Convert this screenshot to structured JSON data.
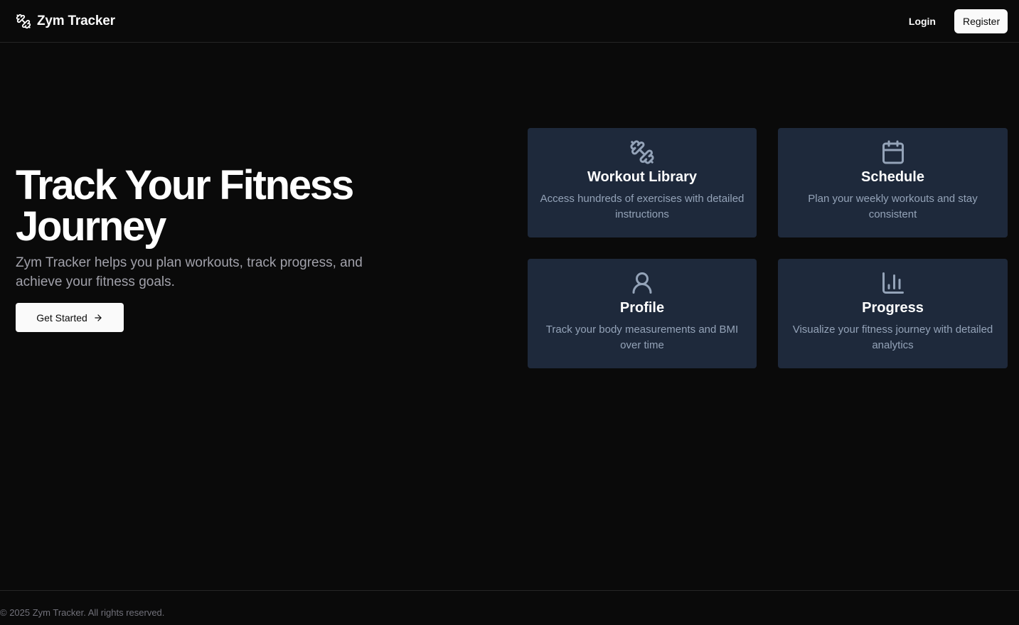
{
  "header": {
    "brand_name": "Zym Tracker",
    "brand_icon": "dumbbell-icon",
    "login_label": "Login",
    "register_label": "Register"
  },
  "hero": {
    "title_line1": "Track Your Fitness",
    "title_line2": "Journey",
    "subtitle": "Zym Tracker helps you plan workouts, track progress, and achieve your fitness goals.",
    "cta_label": "Get Started",
    "cta_icon": "arrow-right-icon"
  },
  "features": [
    {
      "icon": "dumbbell-icon",
      "title": "Workout Library",
      "description": "Access hundreds of exercises with detailed instructions"
    },
    {
      "icon": "calendar-icon",
      "title": "Schedule",
      "description": "Plan your weekly workouts and stay consistent"
    },
    {
      "icon": "user-icon",
      "title": "Profile",
      "description": "Track your body measurements and BMI over time"
    },
    {
      "icon": "bar-chart-icon",
      "title": "Progress",
      "description": "Visualize your fitness journey with detailed analytics"
    }
  ],
  "footer": {
    "copyright": "© 2025 Zym Tracker. All rights reserved."
  },
  "colors": {
    "background": "#0a0a0a",
    "card_background": "#1e293b",
    "muted_text": "#94a3b8",
    "button_light": "#fafafa"
  }
}
